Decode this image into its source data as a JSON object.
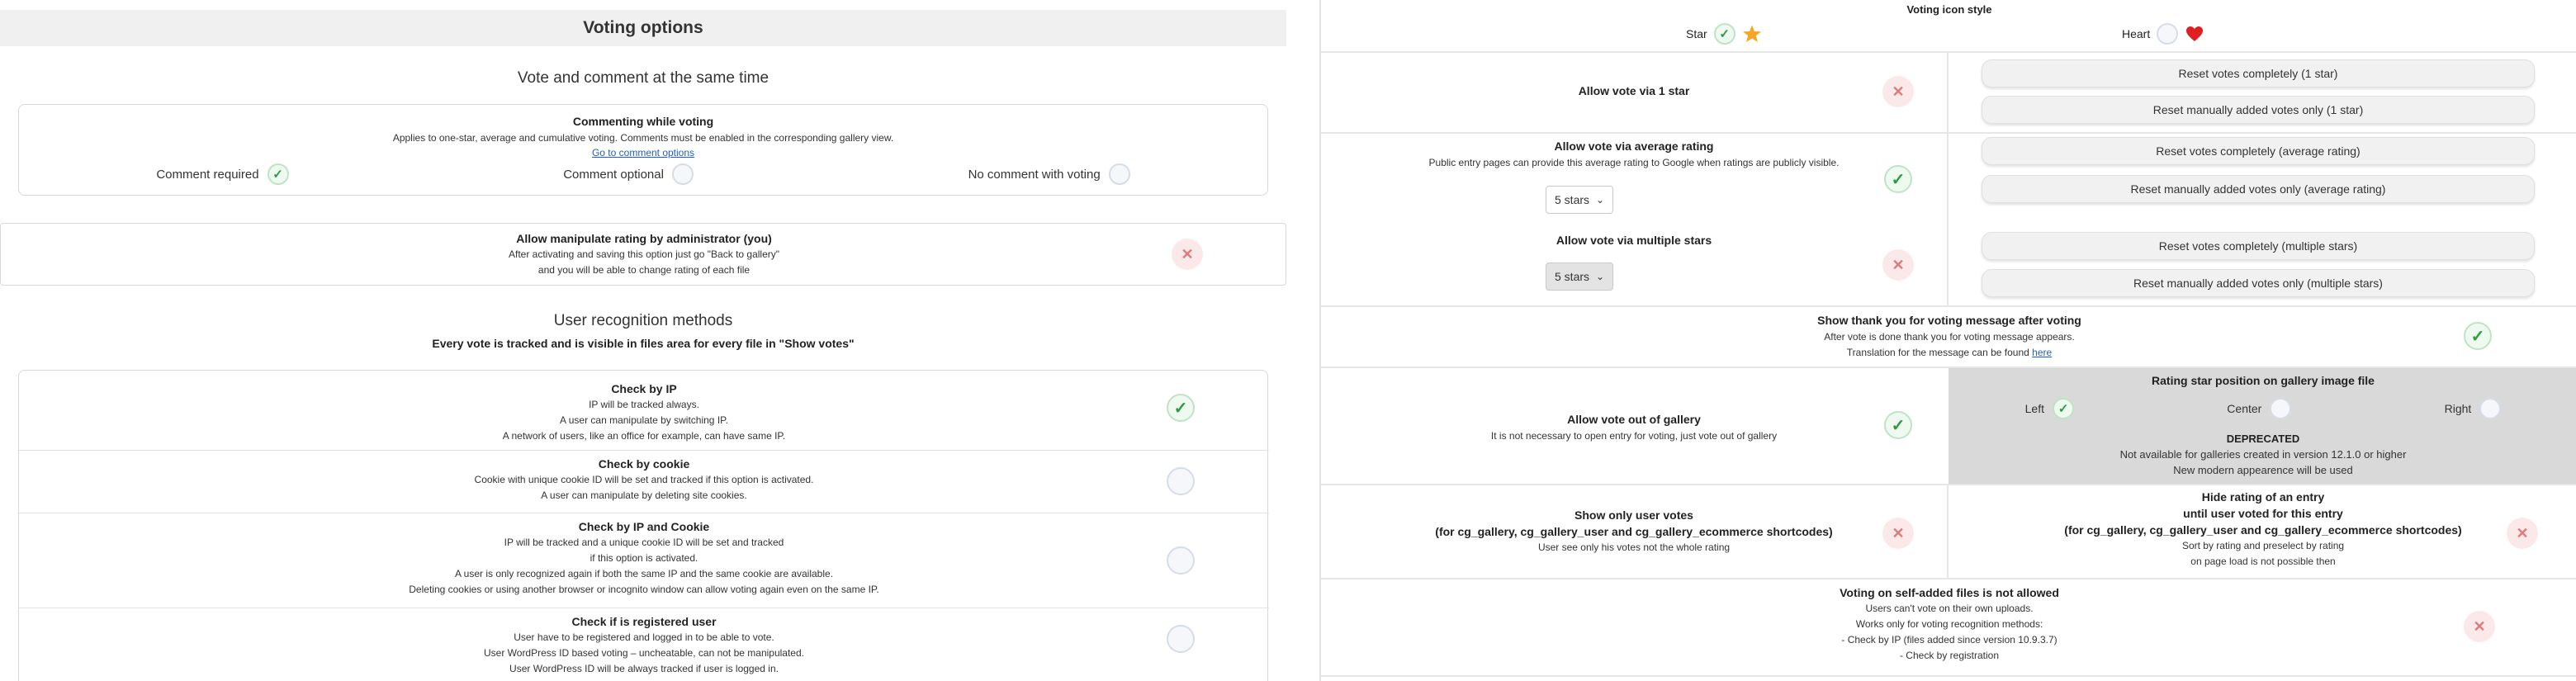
{
  "left": {
    "section_title": "Voting options",
    "vote_comment_title": "Vote and comment at the same time",
    "commenting": {
      "title": "Commenting while voting",
      "desc": "Applies to one-star, average and cumulative voting. Comments must be enabled in the corresponding gallery view.",
      "link": "Go to comment options",
      "options": [
        "Comment required",
        "Comment optional",
        "No comment with voting"
      ]
    },
    "manipulate": {
      "title": "Allow manipulate rating by administrator (you)",
      "line1": "After activating and saving this option just go \"Back to gallery\"",
      "line2": "and you will be able to change rating of each file"
    },
    "recognition_title": "User recognition methods",
    "recognition_sub": "Every vote is tracked and is visible in files area for every file in \"Show votes\"",
    "methods": [
      {
        "title": "Check by IP",
        "lines": [
          "IP will be tracked always.",
          "A user can manipulate by switching IP.",
          "A network of users, like an office for example, can have same IP."
        ]
      },
      {
        "title": "Check by cookie",
        "lines": [
          "Cookie with unique cookie ID will be set and tracked if this option is activated.",
          "A user can manipulate by deleting site cookies."
        ]
      },
      {
        "title": "Check by IP and Cookie",
        "lines": [
          "IP will be tracked and a unique cookie ID will be set and tracked",
          "if this option is activated.",
          "A user is only recognized again if both the same IP and the same cookie are available.",
          "Deleting cookies or using another browser or incognito window can allow voting again even on the same IP."
        ]
      },
      {
        "title": "Check if is registered user",
        "lines": [
          "User have to be registered and logged in to be able to vote.",
          "User WordPress ID based voting – uncheatable, can not be manipulated.",
          "User WordPress ID will be always tracked if user is logged in."
        ]
      }
    ]
  },
  "right": {
    "icon_style_title": "Voting icon style",
    "star_label": "Star",
    "heart_label": "Heart",
    "one_star": {
      "label": "Allow vote via 1 star",
      "btn1": "Reset votes completely (1 star)",
      "btn2": "Reset manually added votes only (1 star)"
    },
    "average": {
      "label": "Allow vote via average rating",
      "desc": "Public entry pages can provide this average rating to Google when ratings are publicly visible.",
      "select": "5 stars",
      "btn1": "Reset votes completely (average rating)",
      "btn2": "Reset manually added votes only (average rating)"
    },
    "multiple": {
      "label": "Allow vote via multiple stars",
      "select": "5 stars",
      "btn1": "Reset votes completely (multiple stars)",
      "btn2": "Reset manually added votes only (multiple stars)"
    },
    "thank_you": {
      "title": "Show thank you for voting message after voting",
      "line1": "After vote is done thank you for voting message appears.",
      "line2": "Translation for the message can be found",
      "link": "here"
    },
    "out_of_gallery": {
      "title": "Allow vote out of gallery",
      "desc": "It is not necessary to open entry for voting, just vote out of gallery"
    },
    "star_position": {
      "title": "Rating star position on gallery image file",
      "options": [
        "Left",
        "Center",
        "Right"
      ],
      "deprecated": "DEPRECATED",
      "note1": "Not available for galleries created in version 12.1.0 or higher",
      "note2": "New modern appearence will be used"
    },
    "own_votes": {
      "title1": "Show only user votes",
      "title2": "(for cg_gallery, cg_gallery_user and cg_gallery_ecommerce shortcodes)",
      "desc": "User see only his votes not the whole rating"
    },
    "hide_rating": {
      "title1": "Hide rating of an entry",
      "title2": "until user voted for this entry",
      "title3": "(for cg_gallery, cg_gallery_user and cg_gallery_ecommerce shortcodes)",
      "desc1": "Sort by rating and preselect by rating",
      "desc2": "on page load is not possible then"
    },
    "self_added": {
      "title": "Voting on self-added files is not allowed",
      "lines": [
        "Users can't vote on their own uploads.",
        "Works only for voting recognition methods:",
        "- Check by IP (files added since version 10.9.3.7)",
        "- Check by registration"
      ]
    }
  },
  "colors": {
    "check": "#2c9c42",
    "cross": "#e07a7a",
    "star": "#f5a623",
    "heart": "#e02020",
    "link": "#1f5fbf"
  }
}
